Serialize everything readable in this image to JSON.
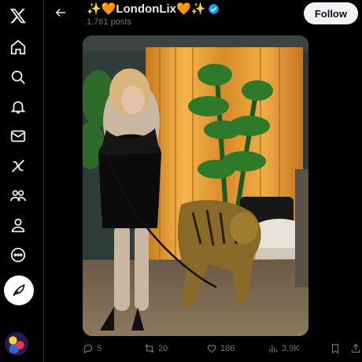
{
  "header": {
    "display_name": "✨🧡LondonLix🧡✨",
    "post_count": "1,761 posts",
    "follow_label": "Follow"
  },
  "nav": {
    "items": [
      "x-logo-icon",
      "home-icon",
      "search-icon",
      "notifications-icon",
      "messages-icon",
      "grok-icon",
      "communities-icon",
      "profile-icon",
      "more-icon"
    ]
  },
  "actions": {
    "replies": "5",
    "reposts": "20",
    "likes": "186",
    "views": "3.9K"
  },
  "colors": {
    "background": "#000000",
    "text_primary": "#e7e9ea",
    "text_secondary": "#71767b",
    "verified": "#1d9bf0",
    "curtain": "#e8a23a"
  }
}
